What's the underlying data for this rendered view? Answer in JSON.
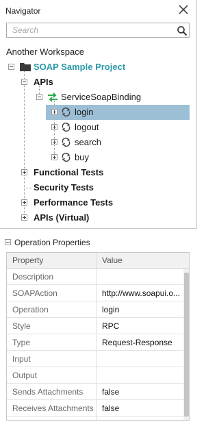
{
  "navigator": {
    "title": "Navigator",
    "search_placeholder": "Search",
    "workspace": "Another Workspace",
    "tree": {
      "project": "SOAP Sample Project",
      "apis": "APIs",
      "binding": "ServiceSoapBinding",
      "operations": [
        "login",
        "logout",
        "search",
        "buy"
      ],
      "selected_operation": "login",
      "functional_tests": "Functional Tests",
      "security_tests": "Security Tests",
      "performance_tests": "Performance Tests",
      "apis_virtual": "APIs (Virtual)"
    }
  },
  "operation_properties": {
    "title": "Operation Properties",
    "columns": [
      "Property",
      "Value"
    ],
    "rows": [
      {
        "property": "Description",
        "value": ""
      },
      {
        "property": "SOAPAction",
        "value": "http://www.soapui.o..."
      },
      {
        "property": "Operation",
        "value": "login"
      },
      {
        "property": "Style",
        "value": "RPC"
      },
      {
        "property": "Type",
        "value": "Request-Response"
      },
      {
        "property": "Input",
        "value": ""
      },
      {
        "property": "Output",
        "value": ""
      },
      {
        "property": "Sends Attachments",
        "value": "false"
      },
      {
        "property": "Receives Attachments",
        "value": "false"
      }
    ]
  },
  "colors": {
    "selection": "#9dbfd6",
    "project_text": "#2a9aa8",
    "binding_arrow_green": "#2fa84f"
  },
  "icons": [
    "close-icon",
    "search-icon",
    "folder-icon",
    "binding-icon",
    "operation-refresh-icon"
  ]
}
